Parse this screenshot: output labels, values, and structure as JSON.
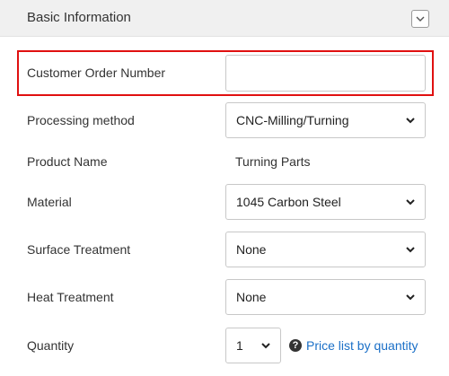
{
  "header": {
    "title": "Basic Information",
    "collapse_icon": "chevron-down-icon"
  },
  "fields": {
    "customer_order_number": {
      "label": "Customer Order Number",
      "value": ""
    },
    "processing_method": {
      "label": "Processing method",
      "value": "CNC-Milling/Turning"
    },
    "product_name": {
      "label": "Product Name",
      "value": "Turning Parts"
    },
    "material": {
      "label": "Material",
      "value": "1045 Carbon Steel"
    },
    "surface_treatment": {
      "label": "Surface Treatment",
      "value": "None"
    },
    "heat_treatment": {
      "label": "Heat Treatment",
      "value": "None"
    },
    "quantity": {
      "label": "Quantity",
      "value": "1",
      "price_link": "Price list by quantity",
      "help_icon": "question-circle-icon"
    }
  },
  "colors": {
    "highlight": "#e01010",
    "link": "#1a6fc7",
    "header_bg": "#f0f0f0"
  }
}
